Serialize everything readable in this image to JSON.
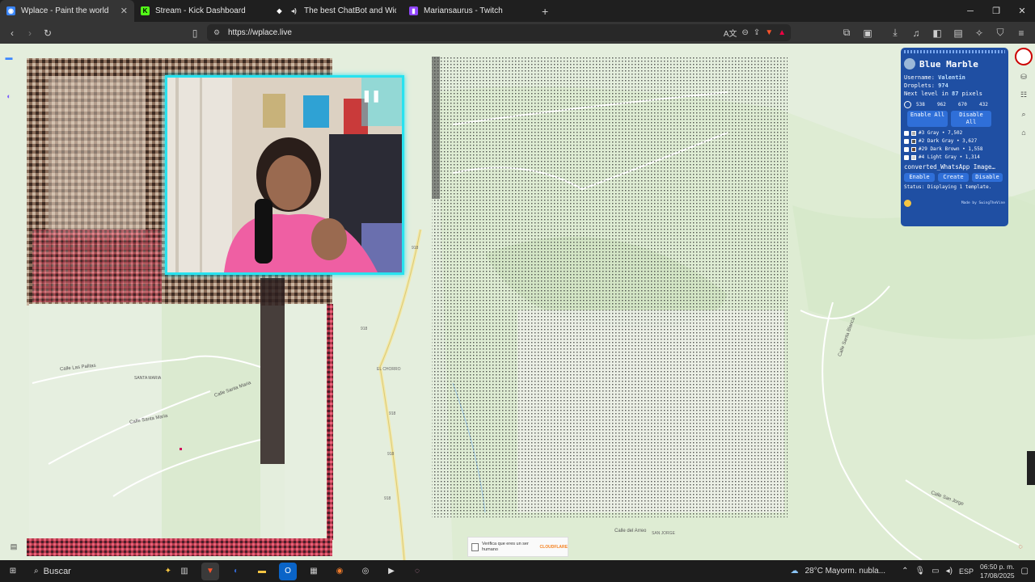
{
  "tabs": [
    {
      "title": "Wplace - Paint the world",
      "active": true,
      "fav_color": "#3a86ff"
    },
    {
      "title": "Stream - Kick Dashboard",
      "active": false,
      "fav_color": "#53fc18"
    },
    {
      "title": "The best ChatBot and Widgets fo",
      "active": false,
      "fav_color": "#ffffff"
    },
    {
      "title": "Mariansaurus - Twitch",
      "active": false,
      "fav_color": "#9146ff"
    }
  ],
  "new_tab": "+",
  "url": "https://wplace.live",
  "panel": {
    "title": "Blue Marble",
    "username_label": "Username:",
    "username": "Valentin",
    "droplets_label": "Droplets:",
    "droplets": "974",
    "next_level": "Next level in",
    "next_level_value": "87",
    "next_level_unit": "pixels",
    "coords": [
      "538",
      "962",
      "670",
      "432"
    ],
    "enable_all": "Enable All",
    "disable_all": "Disable All",
    "colors": [
      {
        "label": "#3 Gray • 7,502",
        "swatch": "#aaaaaa"
      },
      {
        "label": "#2 Dark Gray • 3,627",
        "swatch": "#555555"
      },
      {
        "label": "#29 Dark Brown • 1,558",
        "swatch": "#684634"
      },
      {
        "label": "#4 Light Gray • 1,314",
        "swatch": "#d2d2d2"
      }
    ],
    "template_name": "converted_WhatsApp Image…",
    "enable": "Enable",
    "create": "Create",
    "disable": "Disable",
    "status": "Status: Displaying 1 template.",
    "credit": "Made by SwingTheVine"
  },
  "map_labels": [
    "Calle Las Palitas",
    "SANTA MARIA",
    "Calle Santa Maria",
    "Calle Santa Maria",
    "EL CHORRO",
    "Calle Santa Blanca",
    "Calle San Jorge",
    "Calle del Arreo",
    "SAN JORGE",
    "918",
    "918",
    "918",
    "918",
    "918"
  ],
  "captcha": {
    "text": "Verifica que eres un ser humano",
    "brand": "CLOUDFLARE"
  },
  "taskbar": {
    "search": "Buscar",
    "weather": "28°C  Mayorm. nubla...",
    "lang": "ESP",
    "time": "06:50 p. m.",
    "date": "17/08/2025"
  }
}
